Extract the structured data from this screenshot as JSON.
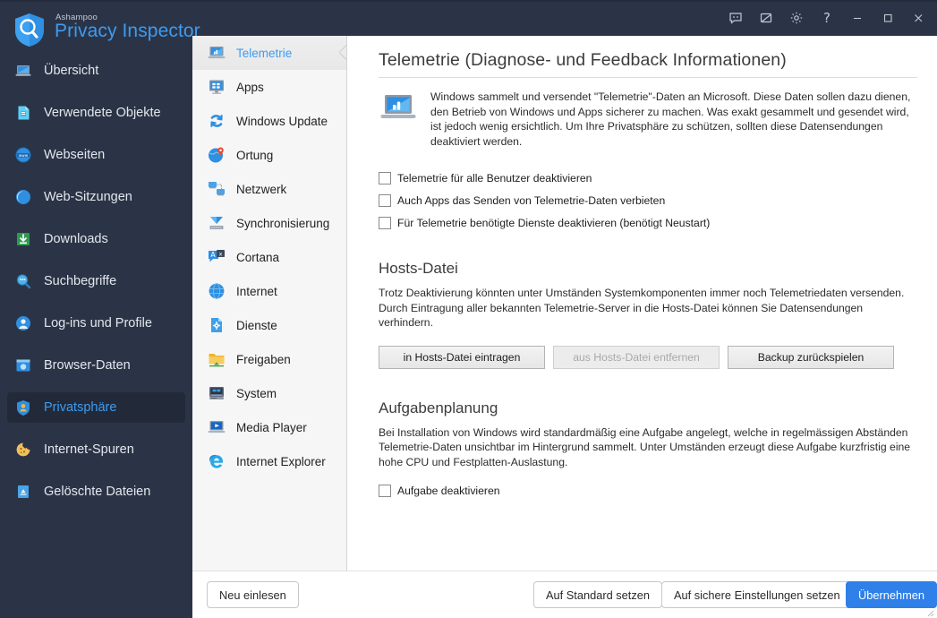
{
  "window": {
    "vendor": "Ashampoo",
    "product": "Privacy Inspector",
    "controls": [
      {
        "name": "feedback-icon",
        "label": "feedback"
      },
      {
        "name": "theme-icon",
        "label": "theme"
      },
      {
        "name": "gear-icon",
        "label": "settings"
      },
      {
        "name": "help-icon",
        "label": "?"
      },
      {
        "name": "minimize-icon",
        "label": "–"
      },
      {
        "name": "maximize-icon",
        "label": "□"
      },
      {
        "name": "close-icon",
        "label": "✕"
      }
    ]
  },
  "sidebar": {
    "items": [
      {
        "label": "Übersicht",
        "icon": "laptop-icon",
        "active": false
      },
      {
        "label": "Verwendete Objekte",
        "icon": "document-icon",
        "active": false
      },
      {
        "label": "Webseiten",
        "icon": "globe-www-icon",
        "active": false
      },
      {
        "label": "Web-Sitzungen",
        "icon": "session-globe-icon",
        "active": false
      },
      {
        "label": "Downloads",
        "icon": "download-icon",
        "active": false
      },
      {
        "label": "Suchbegriffe",
        "icon": "search-icon",
        "active": false
      },
      {
        "label": "Log-ins und Profile",
        "icon": "user-icon",
        "active": false
      },
      {
        "label": "Browser-Daten",
        "icon": "browser-icon",
        "active": false
      },
      {
        "label": "Privatsphäre",
        "icon": "shield-user-icon",
        "active": true
      },
      {
        "label": "Internet-Spuren",
        "icon": "cookie-icon",
        "active": false
      },
      {
        "label": "Gelöschte Dateien",
        "icon": "recycle-bin-icon",
        "active": false
      }
    ]
  },
  "nav": {
    "items": [
      {
        "label": "Telemetrie",
        "icon": "laptop-chart-icon",
        "active": true
      },
      {
        "label": "Apps",
        "icon": "apps-monitor-icon",
        "active": false
      },
      {
        "label": "Windows Update",
        "icon": "refresh-icon",
        "active": false
      },
      {
        "label": "Ortung",
        "icon": "location-globe-icon",
        "active": false
      },
      {
        "label": "Netzwerk",
        "icon": "network-icon",
        "active": false
      },
      {
        "label": "Synchronisierung",
        "icon": "sync-icon",
        "active": false
      },
      {
        "label": "Cortana",
        "icon": "cortana-translate-icon",
        "active": false
      },
      {
        "label": "Internet",
        "icon": "globe-icon",
        "active": false
      },
      {
        "label": "Dienste",
        "icon": "services-gear-doc-icon",
        "active": false
      },
      {
        "label": "Freigaben",
        "icon": "shared-folder-icon",
        "active": false
      },
      {
        "label": "System",
        "icon": "system-icon",
        "active": false
      },
      {
        "label": "Media Player",
        "icon": "media-player-icon",
        "active": false
      },
      {
        "label": "Internet Explorer",
        "icon": "ie-icon",
        "active": false
      }
    ]
  },
  "main": {
    "title": "Telemetrie (Diagnose- und Feedback Informationen)",
    "intro_icon": "laptop-chart-icon",
    "intro": "Windows sammelt und versendet \"Telemetrie\"-Daten an Microsoft. Diese Daten sollen dazu dienen, den Betrieb von Windows und Apps sicherer zu machen. Was exakt gesammelt und gesendet wird, ist jedoch wenig ersichtlich. Um Ihre Privatsphäre zu schützen, sollten diese Datensendungen deaktiviert werden.",
    "checkboxes": [
      {
        "label": "Telemetrie für alle Benutzer deaktivieren",
        "checked": false
      },
      {
        "label": "Auch Apps das Senden von Telemetrie-Daten verbieten",
        "checked": false
      },
      {
        "label": "Für Telemetrie benötigte Dienste deaktivieren (benötigt Neustart)",
        "checked": false
      }
    ],
    "hosts": {
      "title": "Hosts-Datei",
      "desc": "Trotz Deaktivierung könnten unter Umständen Systemkomponenten immer noch Telemetriedaten versenden. Durch Eintragung aller bekannten Telemetrie-Server in die Hosts-Datei können Sie Datensendungen verhindern.",
      "buttons": [
        {
          "label": "in Hosts-Datei eintragen",
          "disabled": false
        },
        {
          "label": "aus Hosts-Datei entfernen",
          "disabled": true
        },
        {
          "label": "Backup zurückspielen",
          "disabled": false
        }
      ]
    },
    "tasks": {
      "title": "Aufgabenplanung",
      "desc": "Bei Installation von Windows wird standardmäßig eine Aufgabe angelegt, welche in regelmässigen Abständen Telemetrie-Daten unsichtbar im Hintergrund sammelt. Unter Umständen erzeugt diese Aufgabe kurzfristig eine hohe CPU und Festplatten-Auslastung.",
      "checkbox": {
        "label": "Aufgabe deaktivieren",
        "checked": false
      }
    }
  },
  "footer": {
    "reload": "Neu einlesen",
    "default": "Auf Standard setzen",
    "secure": "Auf sichere Einstellungen setzen",
    "apply": "Übernehmen"
  },
  "colors": {
    "sidebar_bg": "#2b3446",
    "accent": "#3e9bf0",
    "primary_button": "#2f80e8",
    "nav_bg": "#f6f6f6"
  }
}
